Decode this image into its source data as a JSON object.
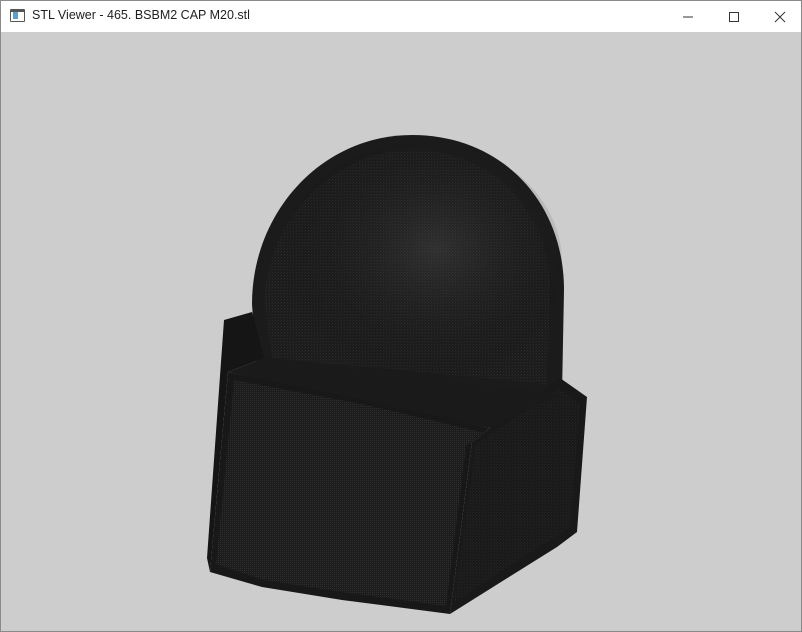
{
  "window": {
    "title": "STL Viewer - 465. BSBM2 CAP M20.stl",
    "icon": "stl-viewer-app-icon",
    "controls": {
      "minimize_icon": "minimize-icon",
      "maximize_icon": "maximize-icon",
      "close_icon": "close-icon"
    }
  },
  "viewport": {
    "model": "cap-nut-3d-mesh",
    "background_color": "#cdcdcd",
    "mesh_color": "#1c1c1c"
  }
}
